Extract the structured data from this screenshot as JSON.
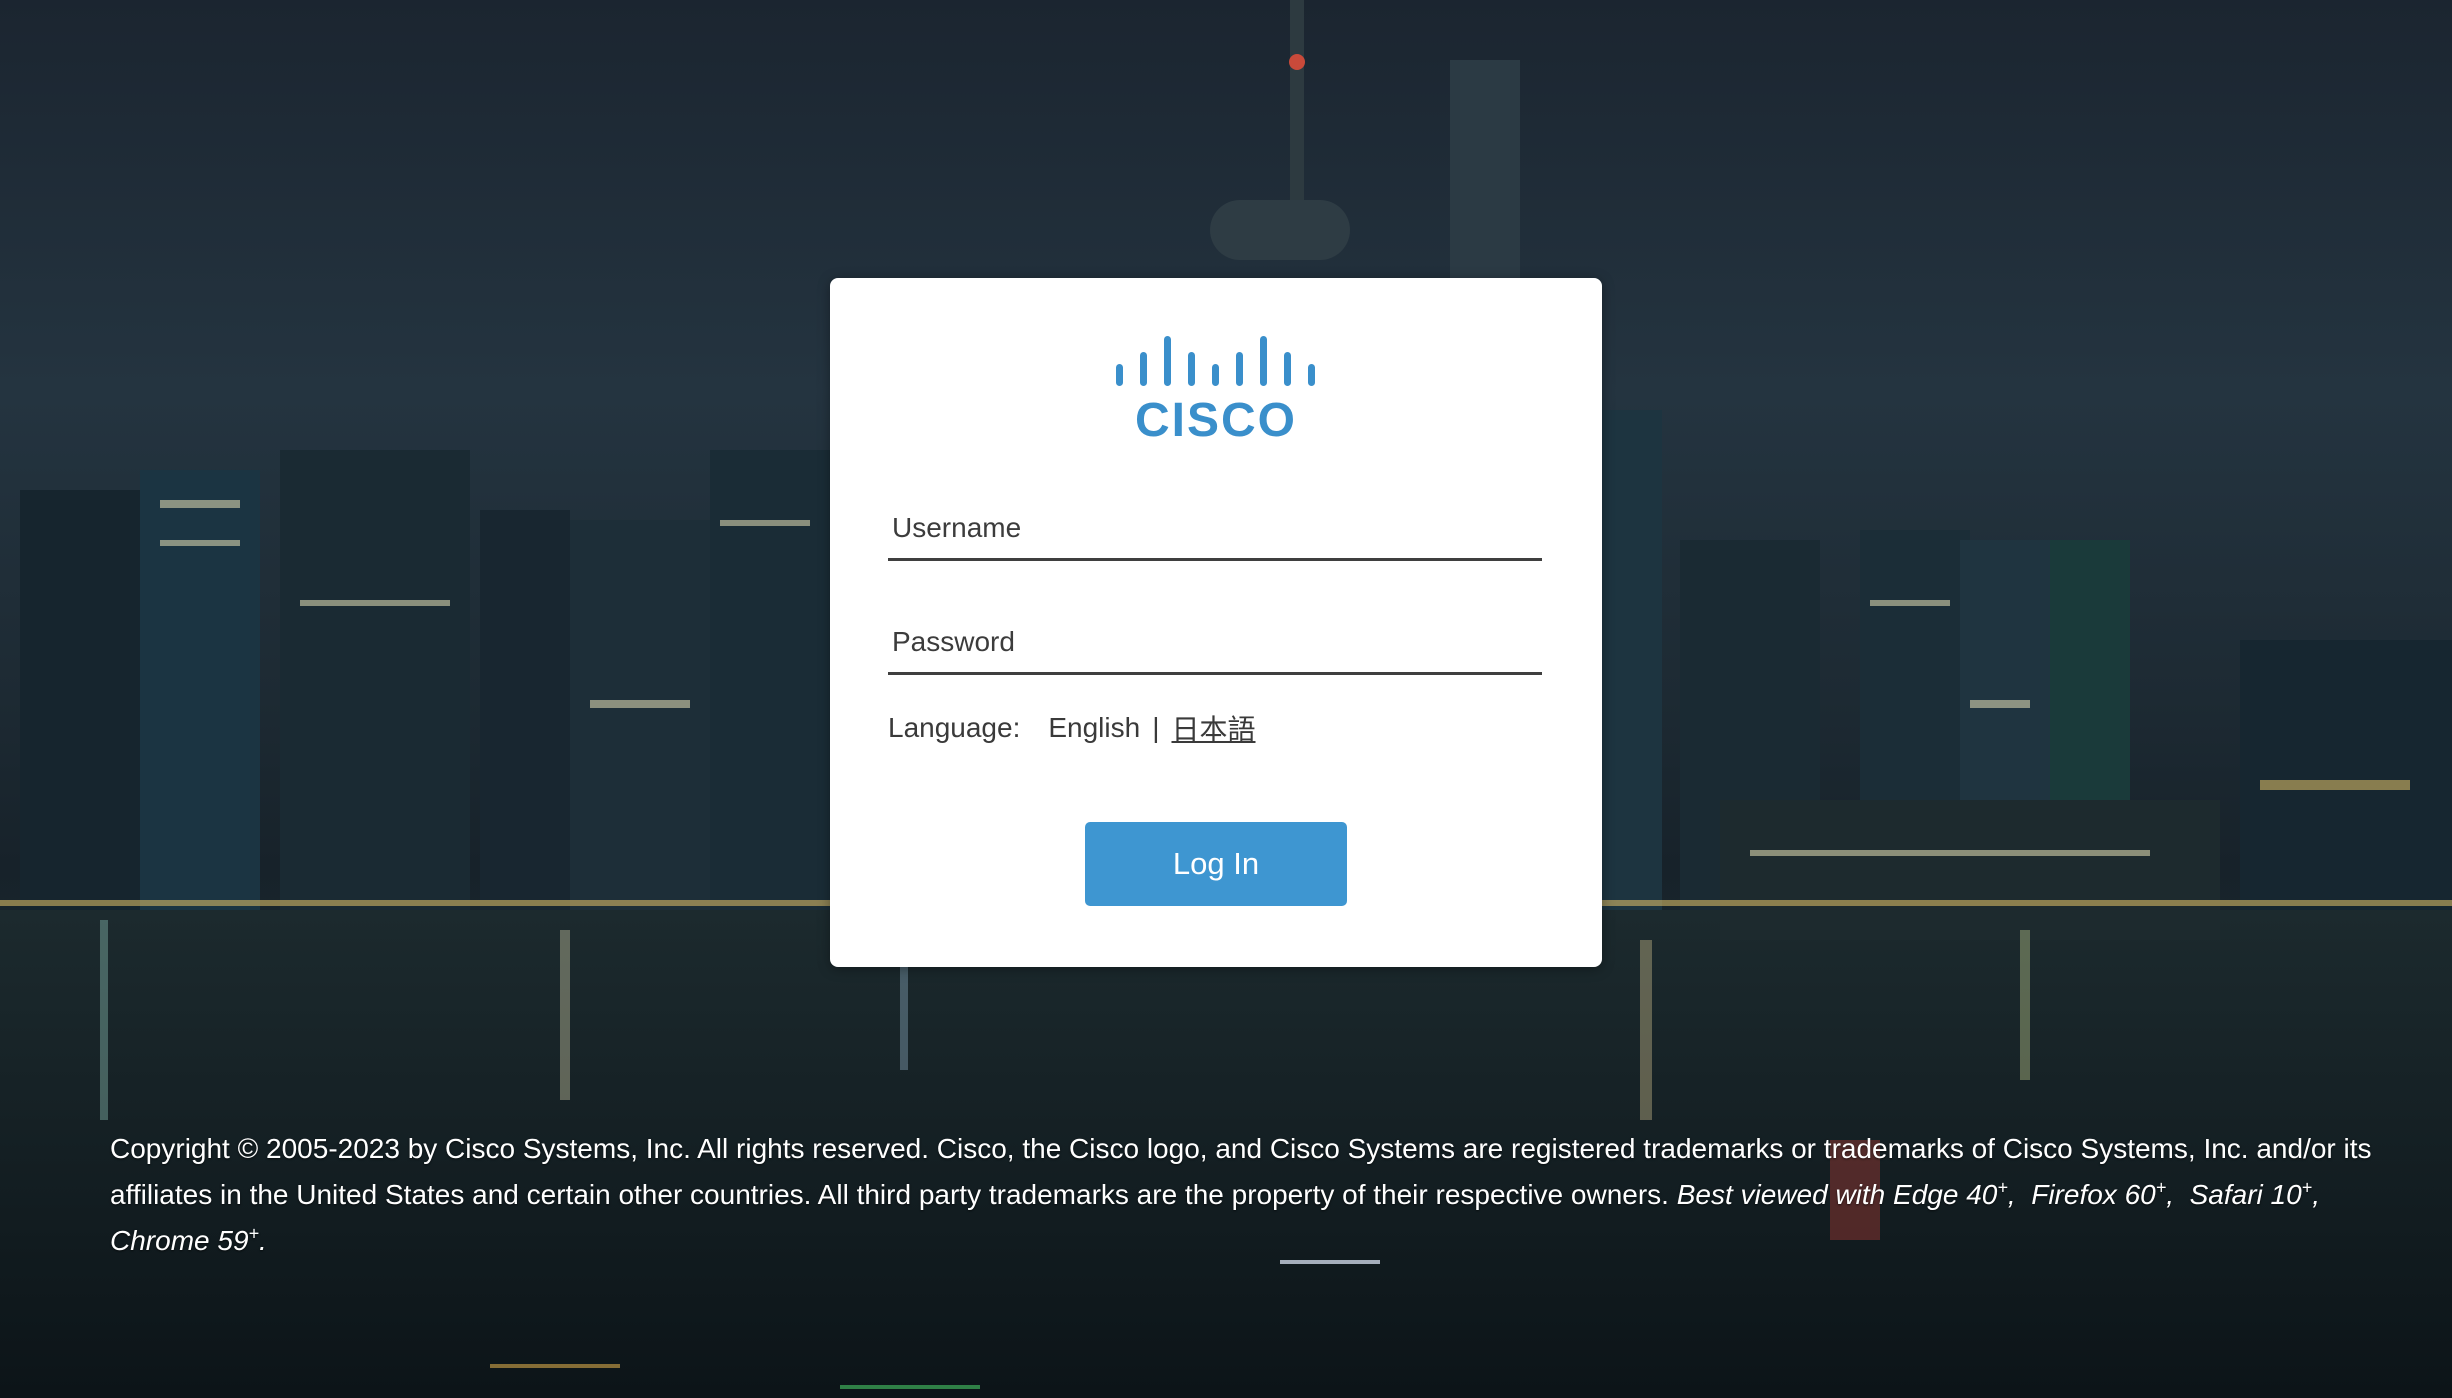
{
  "logo": {
    "text": "CISCO",
    "icon": "cisco-bridge-logo",
    "color": "#3a8fcb"
  },
  "form": {
    "username_placeholder": "Username",
    "username_value": "",
    "password_placeholder": "Password",
    "password_value": "",
    "language_label": "Language:",
    "language_options": [
      "English",
      "日本語"
    ],
    "language_separator": "|",
    "login_label": "Log In",
    "button_color": "#3e96d1"
  },
  "footer": {
    "copyright": "Copyright © 2005-2023 by Cisco Systems, Inc. All rights reserved. Cisco, the Cisco logo, and Cisco Systems are registered trademarks or trademarks of Cisco Systems, Inc. and/or its affiliates in the United States and certain other countries. All third party trademarks are the property of their respective owners.",
    "best_viewed_prefix": "Best viewed with",
    "browsers": [
      {
        "name": "Edge 40",
        "sup": "+"
      },
      {
        "name": "Firefox 60",
        "sup": "+"
      },
      {
        "name": "Safari 10",
        "sup": "+"
      },
      {
        "name": "Chrome 59",
        "sup": "+"
      }
    ]
  }
}
